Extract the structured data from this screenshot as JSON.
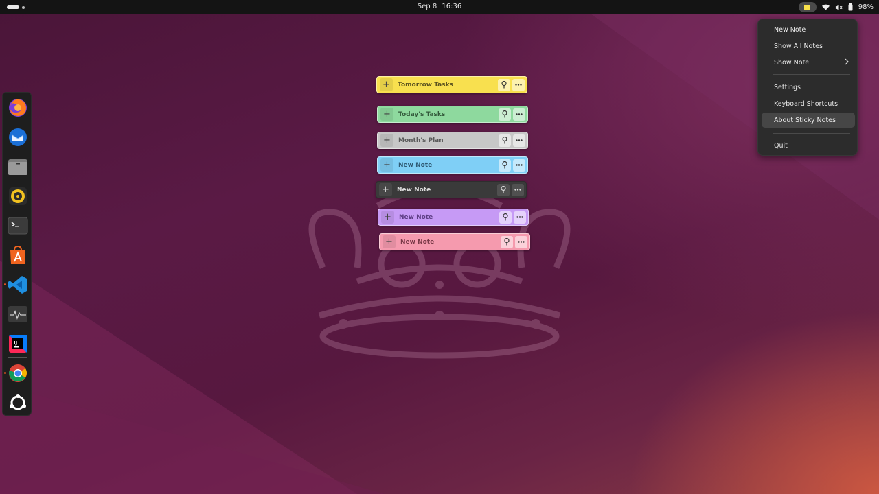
{
  "topbar": {
    "date": "Sep 8",
    "time": "16:36",
    "battery": "98%"
  },
  "dock": {
    "apps": [
      "Firefox",
      "Thunderbird",
      "Files",
      "Rhythmbox",
      "Terminal",
      "App Center",
      "Visual Studio Code",
      "System Monitor",
      "IntelliJ IDEA",
      "Google Chrome",
      "Show Apps"
    ]
  },
  "notes": [
    {
      "title": "Tomorrow Tasks",
      "color": "#f8e04f"
    },
    {
      "title": "Today's Tasks",
      "color": "#8ed99e"
    },
    {
      "title": "Month's Plan",
      "color": "#c7c7c7"
    },
    {
      "title": "New Note",
      "color": "#7fcff6"
    },
    {
      "title": "New Note",
      "color": "#3a3a3a"
    },
    {
      "title": "New Note",
      "color": "#c69af5"
    },
    {
      "title": "New Note",
      "color": "#f59aae"
    }
  ],
  "menu": {
    "new_note": "New Note",
    "show_all_notes": "Show All Notes",
    "show_note": "Show Note",
    "settings": "Settings",
    "keyboard_shortcuts": "Keyboard Shortcuts",
    "about": "About Sticky Notes",
    "quit": "Quit"
  }
}
